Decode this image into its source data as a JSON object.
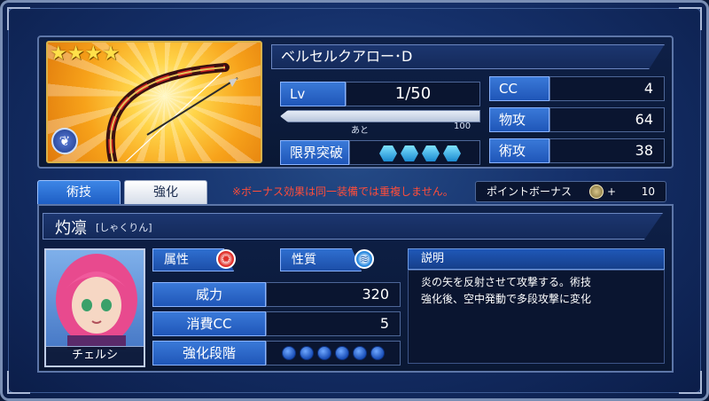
{
  "weapon": {
    "name": "ベルセルクアロー･D",
    "rarity_stars": 4,
    "level_label": "Lv",
    "level_value": "1/50",
    "exp_next_label": "あと",
    "exp_next_value": "100",
    "limit_break_label": "限界突破",
    "limit_break_gems": 4,
    "stats": [
      {
        "label": "CC",
        "value": "4"
      },
      {
        "label": "物攻",
        "value": "64"
      },
      {
        "label": "術攻",
        "value": "38"
      }
    ]
  },
  "tabs": {
    "skill_label": "術技",
    "enhance_label": "強化"
  },
  "bonus_note": "※ボーナス効果は同一装備では重複しません。",
  "point_bonus": {
    "label": "ポイントボーナス",
    "plus": "+",
    "value": "10"
  },
  "skill": {
    "name": "灼凛",
    "reading": "[しゃくりん]",
    "character_name": "チェルシ",
    "attribute_label": "属性",
    "attribute_icon": "fire-element-icon",
    "nature_label": "性質",
    "nature_icon": "wind-element-icon",
    "description_label": "説明",
    "description": "炎の矢を反射させて攻撃する。術技\n強化後、空中発動で多段攻撃に変化",
    "rows": [
      {
        "label": "威力",
        "value": "320"
      },
      {
        "label": "消費CC",
        "value": "5"
      },
      {
        "label": "強化段階",
        "value": ""
      }
    ],
    "enhance_steps": 6
  },
  "colors": {
    "accent_blue": "#2f6fd0",
    "warning_red": "#ff4d3a",
    "card_gold": "#f7a21a"
  }
}
